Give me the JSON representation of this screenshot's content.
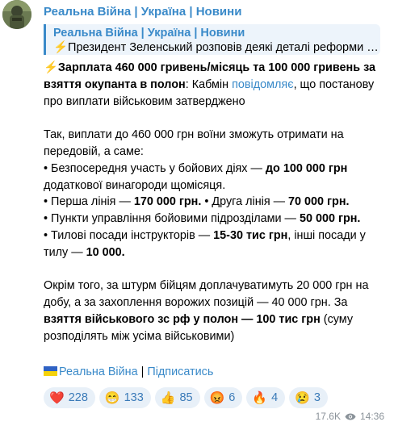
{
  "channel": {
    "name": "Реальна Війна | Україна | Новини"
  },
  "reply": {
    "title": "Реальна Війна | Україна | Новини",
    "text": "⚡Президент Зеленський розповів деякі деталі реформи а…"
  },
  "message": {
    "headline_emoji": "⚡",
    "headline_bold": "Зарплата 460 000 гривень/місяць та 100 000 гривень за взяття окупанта в полон",
    "headline_rest_1": ": Кабмін ",
    "headline_link": "повідомляє",
    "headline_rest_2": ", що постанову про виплати військовим затверджено",
    "p2_intro": "Так, виплати до 460 000 грн воїни зможуть отримати на передовій, а саме:",
    "b1_a": "• Безпосередня участь у бойових діях — ",
    "b1_b": "до 100 000 грн",
    "b1_c": " додаткової винагороди щомісяця.",
    "b2_a": "• Перша лінія — ",
    "b2_b": "170 000 грн.",
    "b2_c": " • Друга лінія — ",
    "b2_d": "70 000 грн.",
    "b3_a": "• Пункти управління бойовими підрозділами — ",
    "b3_b": "50 000 грн.",
    "b4_a": "• Тилові посади інструкторів — ",
    "b4_b": "15-30 тис грн",
    "b4_c": ", інші посади у тилу — ",
    "b4_d": "10 000.",
    "p3_a": "Окрім того, за штурм бійцям доплачуватимуть 20 000 грн на добу, а за захоплення ворожих позицій — 40 000 грн. За ",
    "p3_b": "взяття військового зс рф у полон — 100 тис грн",
    "p3_c": " (суму розподілять між усіма військовими)"
  },
  "footer": {
    "channel_link": "Реальна Війна",
    "separator": " | ",
    "subscribe": "Підписатись"
  },
  "reactions": [
    {
      "emoji": "❤️",
      "icon": "heart-icon",
      "count": "228"
    },
    {
      "emoji": "😁",
      "icon": "grin-icon",
      "count": "133"
    },
    {
      "emoji": "👍",
      "icon": "thumbs-up-icon",
      "count": "85"
    },
    {
      "emoji": "😡",
      "icon": "angry-icon",
      "count": "6"
    },
    {
      "emoji": "🔥",
      "icon": "fire-icon",
      "count": "4"
    },
    {
      "emoji": "😢",
      "icon": "cry-icon",
      "count": "3"
    }
  ],
  "meta": {
    "views": "17.6K",
    "time": "14:36"
  },
  "colors": {
    "accent": "#3a8ac9",
    "reaction_bg": "#e8f0f8"
  }
}
